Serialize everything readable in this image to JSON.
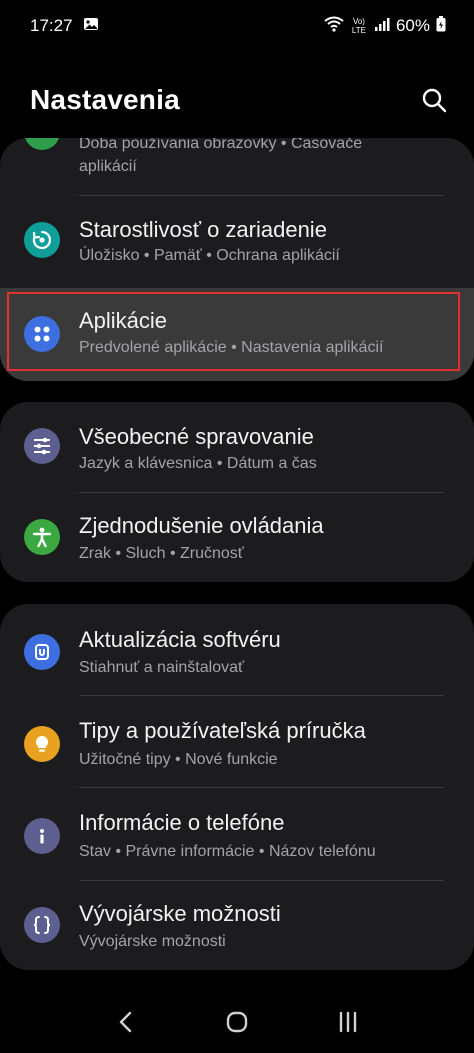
{
  "status_bar": {
    "time": "17:27",
    "network_label": "Vo) LTE",
    "battery": "60%"
  },
  "header": {
    "title": "Nastavenia"
  },
  "groups": [
    {
      "items": [
        {
          "subtitle_line1": "Doba používania obrazovky  •  Časovače",
          "subtitle_line2": "aplikácií",
          "icon": "digital-wellbeing-icon",
          "icon_color": "#2e9d4e"
        },
        {
          "title": "Starostlivosť o zariadenie",
          "subtitle": "Úložisko  •  Pamäť  •  Ochrana aplikácií",
          "icon": "device-care-icon",
          "icon_color": "#0f9e9a"
        },
        {
          "title": "Aplikácie",
          "subtitle": "Predvolené aplikácie  •  Nastavenia aplikácií",
          "icon": "apps-icon",
          "icon_color": "#3d6fe0",
          "highlighted": true
        }
      ]
    },
    {
      "items": [
        {
          "title": "Všeobecné spravovanie",
          "subtitle": "Jazyk a klávesnica  •  Dátum a čas",
          "icon": "general-management-icon",
          "icon_color": "#5c5f8f"
        },
        {
          "title": "Zjednodušenie ovládania",
          "subtitle": "Zrak  •  Sluch  •  Zručnosť",
          "icon": "accessibility-icon",
          "icon_color": "#3ba842"
        }
      ]
    },
    {
      "items": [
        {
          "title": "Aktualizácia softvéru",
          "subtitle": "Stiahnuť a nainštalovať",
          "icon": "software-update-icon",
          "icon_color": "#3d6fe0"
        },
        {
          "title": "Tipy a používateľská príručka",
          "subtitle": "Užitočné tipy  •  Nové funkcie",
          "icon": "tips-icon",
          "icon_color": "#e9a21f"
        },
        {
          "title": "Informácie o telefóne",
          "subtitle": "Stav  •  Právne informácie  •  Názov telefónu",
          "icon": "info-icon",
          "icon_color": "#5c5f8f"
        },
        {
          "title": "Vývojárske možnosti",
          "subtitle": "Vývojárske možnosti",
          "icon": "developer-options-icon",
          "icon_color": "#5c5f8f"
        }
      ]
    }
  ],
  "nav_bar": {
    "icons": [
      "back-icon",
      "home-icon",
      "recents-icon"
    ]
  }
}
